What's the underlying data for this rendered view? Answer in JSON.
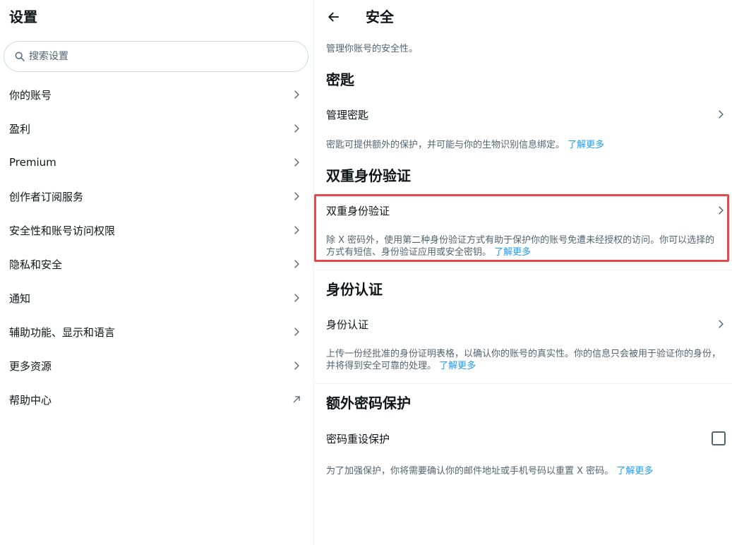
{
  "left": {
    "title": "设置",
    "search_placeholder": "搜索设置",
    "items": [
      {
        "label": "你的账号",
        "icon": "chevron-right-icon"
      },
      {
        "label": "盈利",
        "icon": "chevron-right-icon"
      },
      {
        "label": "Premium",
        "icon": "chevron-right-icon"
      },
      {
        "label": "创作者订阅服务",
        "icon": "chevron-right-icon"
      },
      {
        "label": "安全性和账号访问权限",
        "icon": "chevron-right-icon"
      },
      {
        "label": "隐私和安全",
        "icon": "chevron-right-icon"
      },
      {
        "label": "通知",
        "icon": "chevron-right-icon"
      },
      {
        "label": "辅助功能、显示和语言",
        "icon": "chevron-right-icon"
      },
      {
        "label": "更多资源",
        "icon": "chevron-right-icon"
      },
      {
        "label": "帮助中心",
        "icon": "external-arrow-icon"
      }
    ]
  },
  "right": {
    "title": "安全",
    "subtitle": "管理你账号的安全性。",
    "passkey": {
      "heading": "密匙",
      "row_label": "管理密匙",
      "desc": "密匙可提供额外的保护，并可能与你的生物识别信息绑定。",
      "link": "了解更多"
    },
    "twofa": {
      "heading": "双重身份验证",
      "row_label": "双重身份验证",
      "desc": "除 X 密码外，使用第二种身份验证方式有助于保护你的账号免遭未经授权的访问。你可以选择的方式有短信、身份验证应用或安全密钥。",
      "link": "了解更多"
    },
    "id": {
      "heading": "身份认证",
      "row_label": "身份认证",
      "desc": "上传一份经批准的身份证明表格，以确认你的账号的真实性。你的信息只会被用于验证你的身份，并将得到安全可靠的处理。",
      "link": "了解更多"
    },
    "extra": {
      "heading": "额外密码保护",
      "row_label": "密码重设保护",
      "desc": "为了加强保护，你将需要确认你的邮件地址或手机号码以重置 X 密码。",
      "link": "了解更多"
    }
  },
  "colors": {
    "accent": "#1d9bf0",
    "highlight": "#e5484d",
    "muted": "#536471"
  }
}
